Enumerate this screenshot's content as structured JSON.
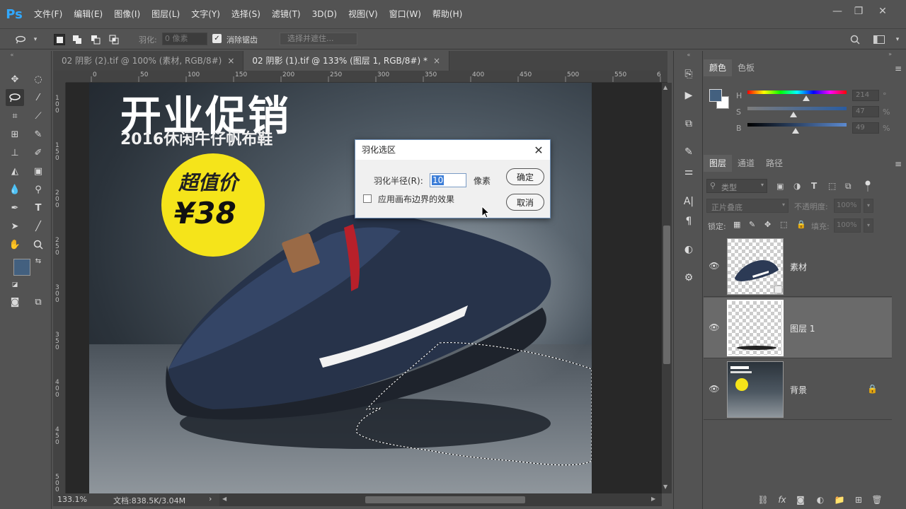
{
  "app": {
    "logo": "Ps"
  },
  "menu": [
    "文件(F)",
    "编辑(E)",
    "图像(I)",
    "图层(L)",
    "文字(Y)",
    "选择(S)",
    "滤镜(T)",
    "3D(D)",
    "视图(V)",
    "窗口(W)",
    "帮助(H)"
  ],
  "options": {
    "feather_label": "羽化:",
    "feather_value": "0 像素",
    "antialias_label": "消除锯齿",
    "antialias_checked": true,
    "select_mask_button": "选择并遮住..."
  },
  "tabs": [
    {
      "label": "02 阴影 (2).tif @ 100% (素材, RGB/8#)",
      "close": "×",
      "active": false
    },
    {
      "label": "02 阴影 (1).tif @ 133% (图层 1, RGB/8#) *",
      "close": "×",
      "active": true
    }
  ],
  "rulers": {
    "top_ticks": [
      "0",
      "50",
      "100",
      "150",
      "200",
      "250",
      "300",
      "350",
      "400",
      "450",
      "500",
      "550",
      "6"
    ],
    "left_ticks": [
      "100",
      "150",
      "200",
      "250",
      "300",
      "350",
      "400",
      "450",
      "500"
    ]
  },
  "artwork": {
    "headline": "开业促销",
    "subhead": "2016休闲牛仔帆布鞋",
    "price_label": "超值价",
    "price_value": "¥38"
  },
  "dialog": {
    "title": "羽化选区",
    "radius_label": "羽化半径(R):",
    "radius_value": "10",
    "unit": "像素",
    "canvas_bounds_label": "应用画布边界的效果",
    "canvas_bounds_checked": false,
    "ok": "确定",
    "cancel": "取消"
  },
  "status": {
    "zoom": "133.1%",
    "doc": "文档:838.5K/3.04M"
  },
  "color_panel": {
    "tabs": [
      "颜色",
      "色板"
    ],
    "sliders": [
      {
        "label": "H",
        "value": "214",
        "unit": "°"
      },
      {
        "label": "S",
        "value": "47",
        "unit": "%"
      },
      {
        "label": "B",
        "value": "49",
        "unit": "%"
      }
    ],
    "foreground": "#43607f",
    "background": "#ffffff"
  },
  "layers_panel": {
    "tabs": [
      "图层",
      "通道",
      "路径"
    ],
    "filter_label": "类型",
    "blend_mode": "正片叠底",
    "opacity_label": "不透明度:",
    "opacity_value": "100%",
    "lock_label": "锁定:",
    "fill_label": "填充:",
    "fill_value": "100%",
    "layers": [
      {
        "name": "素材",
        "selected": false,
        "locked": false
      },
      {
        "name": "图层 1",
        "selected": true,
        "locked": false
      },
      {
        "name": "背景",
        "selected": false,
        "locked": true
      }
    ]
  },
  "toolbar": {
    "foreground_color": "#43607f",
    "background_color": "#ffffff"
  }
}
